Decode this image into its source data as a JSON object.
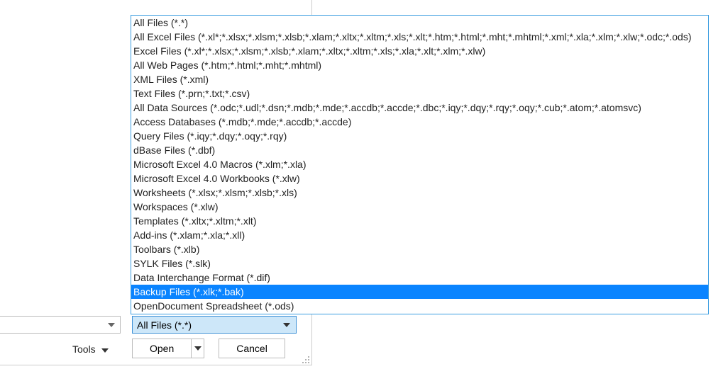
{
  "fileTypeOptions": [
    "All Files (*.*)",
    "All Excel Files (*.xl*;*.xlsx;*.xlsm;*.xlsb;*.xlam;*.xltx;*.xltm;*.xls;*.xlt;*.htm;*.html;*.mht;*.mhtml;*.xml;*.xla;*.xlm;*.xlw;*.odc;*.ods)",
    "Excel Files (*.xl*;*.xlsx;*.xlsm;*.xlsb;*.xlam;*.xltx;*.xltm;*.xls;*.xla;*.xlt;*.xlm;*.xlw)",
    "All Web Pages (*.htm;*.html;*.mht;*.mhtml)",
    "XML Files (*.xml)",
    "Text Files (*.prn;*.txt;*.csv)",
    "All Data Sources (*.odc;*.udl;*.dsn;*.mdb;*.mde;*.accdb;*.accde;*.dbc;*.iqy;*.dqy;*.rqy;*.oqy;*.cub;*.atom;*.atomsvc)",
    "Access Databases (*.mdb;*.mde;*.accdb;*.accde)",
    "Query Files (*.iqy;*.dqy;*.oqy;*.rqy)",
    "dBase Files (*.dbf)",
    "Microsoft Excel 4.0 Macros (*.xlm;*.xla)",
    "Microsoft Excel 4.0 Workbooks (*.xlw)",
    "Worksheets (*.xlsx;*.xlsm;*.xlsb;*.xls)",
    "Workspaces (*.xlw)",
    "Templates (*.xltx;*.xltm;*.xlt)",
    "Add-ins (*.xlam;*.xla;*.xll)",
    "Toolbars (*.xlb)",
    "SYLK Files (*.slk)",
    "Data Interchange Format (*.dif)",
    "Backup Files (*.xlk;*.bak)",
    "OpenDocument Spreadsheet (*.ods)"
  ],
  "selectedOptionIndex": 19,
  "currentFilter": "All Files (*.*)",
  "toolsLabel": "Tools",
  "openLabel": "Open",
  "cancelLabel": "Cancel"
}
